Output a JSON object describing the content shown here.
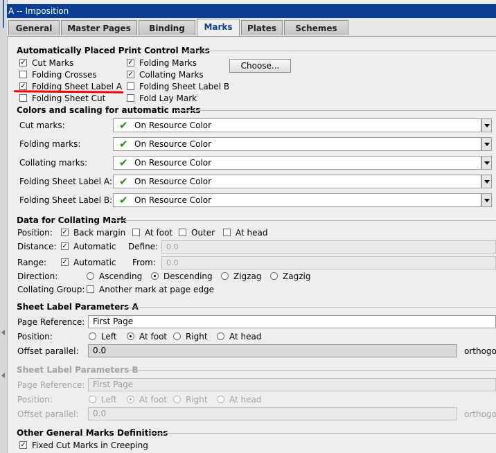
{
  "window": {
    "title": "A -- Imposition"
  },
  "tabs": [
    {
      "label": "General",
      "active": false
    },
    {
      "label": "Master Pages",
      "active": false
    },
    {
      "label": "Binding",
      "active": false
    },
    {
      "label": "Marks",
      "active": true
    },
    {
      "label": "Plates",
      "active": false
    },
    {
      "label": "Schemes",
      "active": false
    }
  ],
  "auto_marks": {
    "heading": "Automatically Placed Print Control Marks",
    "checkboxes": [
      {
        "label": "Cut Marks",
        "checked": true
      },
      {
        "label": "Folding Crosses",
        "checked": false
      },
      {
        "label": "Folding Sheet Label A",
        "checked": true
      },
      {
        "label": "Folding Sheet Cut",
        "checked": false
      },
      {
        "label": "Folding Marks",
        "checked": true
      },
      {
        "label": "Collating Marks",
        "checked": true
      },
      {
        "label": "Folding Sheet Label B",
        "checked": false
      },
      {
        "label": "Fold Lay Mark",
        "checked": false
      }
    ],
    "choose_button": "Choose..."
  },
  "colors": {
    "heading": "Colors and scaling for automatic marks",
    "rows": [
      {
        "label": "Cut marks:",
        "value": "On Resource Color"
      },
      {
        "label": "Folding marks:",
        "value": "On Resource Color"
      },
      {
        "label": "Collating marks:",
        "value": "On Resource Color"
      },
      {
        "label": "Folding Sheet Label A:",
        "value": "On Resource Color"
      },
      {
        "label": "Folding Sheet Label B:",
        "value": "On Resource Color"
      }
    ]
  },
  "collating": {
    "heading": "Data for Collating Mark",
    "position_label": "Position:",
    "position_options": [
      {
        "label": "Back margin",
        "checked": true
      },
      {
        "label": "At foot",
        "checked": false
      },
      {
        "label": "Outer",
        "checked": false
      },
      {
        "label": "At head",
        "checked": false
      }
    ],
    "distance_label": "Distance:",
    "distance_auto": {
      "label": "Automatic",
      "checked": true
    },
    "define_label": "Define:",
    "define_value": "0.0",
    "range_label": "Range:",
    "range_auto": {
      "label": "Automatic",
      "checked": true
    },
    "from_label": "From:",
    "from_value": "0.0",
    "direction_label": "Direction:",
    "direction_options": [
      {
        "label": "Ascending",
        "selected": false
      },
      {
        "label": "Descending",
        "selected": true
      },
      {
        "label": "Zigzag",
        "selected": false
      },
      {
        "label": "Zagzig",
        "selected": false
      }
    ],
    "group_label": "Collating Group:",
    "group_option": {
      "label": "Another mark at page edge",
      "checked": false
    }
  },
  "sheet_label_a": {
    "heading": "Sheet Label Parameters A",
    "page_ref_label": "Page Reference:",
    "page_ref_value": "First Page",
    "position_label": "Position:",
    "positions": [
      {
        "label": "Left",
        "selected": false
      },
      {
        "label": "At foot",
        "selected": true
      },
      {
        "label": "Right",
        "selected": false
      },
      {
        "label": "At head",
        "selected": false
      }
    ],
    "offset_label": "Offset parallel:",
    "offset_value": "0.0",
    "orthogonal_label": "orthogon"
  },
  "sheet_label_b": {
    "heading": "Sheet Label Parameters B",
    "page_ref_label": "Page Reference:",
    "page_ref_value": "First Page",
    "position_label": "Position:",
    "positions": [
      {
        "label": "Left",
        "selected": false
      },
      {
        "label": "At foot",
        "selected": true
      },
      {
        "label": "Right",
        "selected": false
      },
      {
        "label": "At head",
        "selected": false
      }
    ],
    "offset_label": "Offset parallel:",
    "offset_value": "0.0",
    "orthogonal_label": "orthogon"
  },
  "other": {
    "heading": "Other General Marks Definitions",
    "fixed_cut": {
      "label": "Fixed Cut Marks in Creeping",
      "checked": true
    }
  },
  "colors_palette": {
    "title_bar": "#0b3d91",
    "check_green": "#2a8a1a",
    "annotation_red": "#e8000c"
  }
}
